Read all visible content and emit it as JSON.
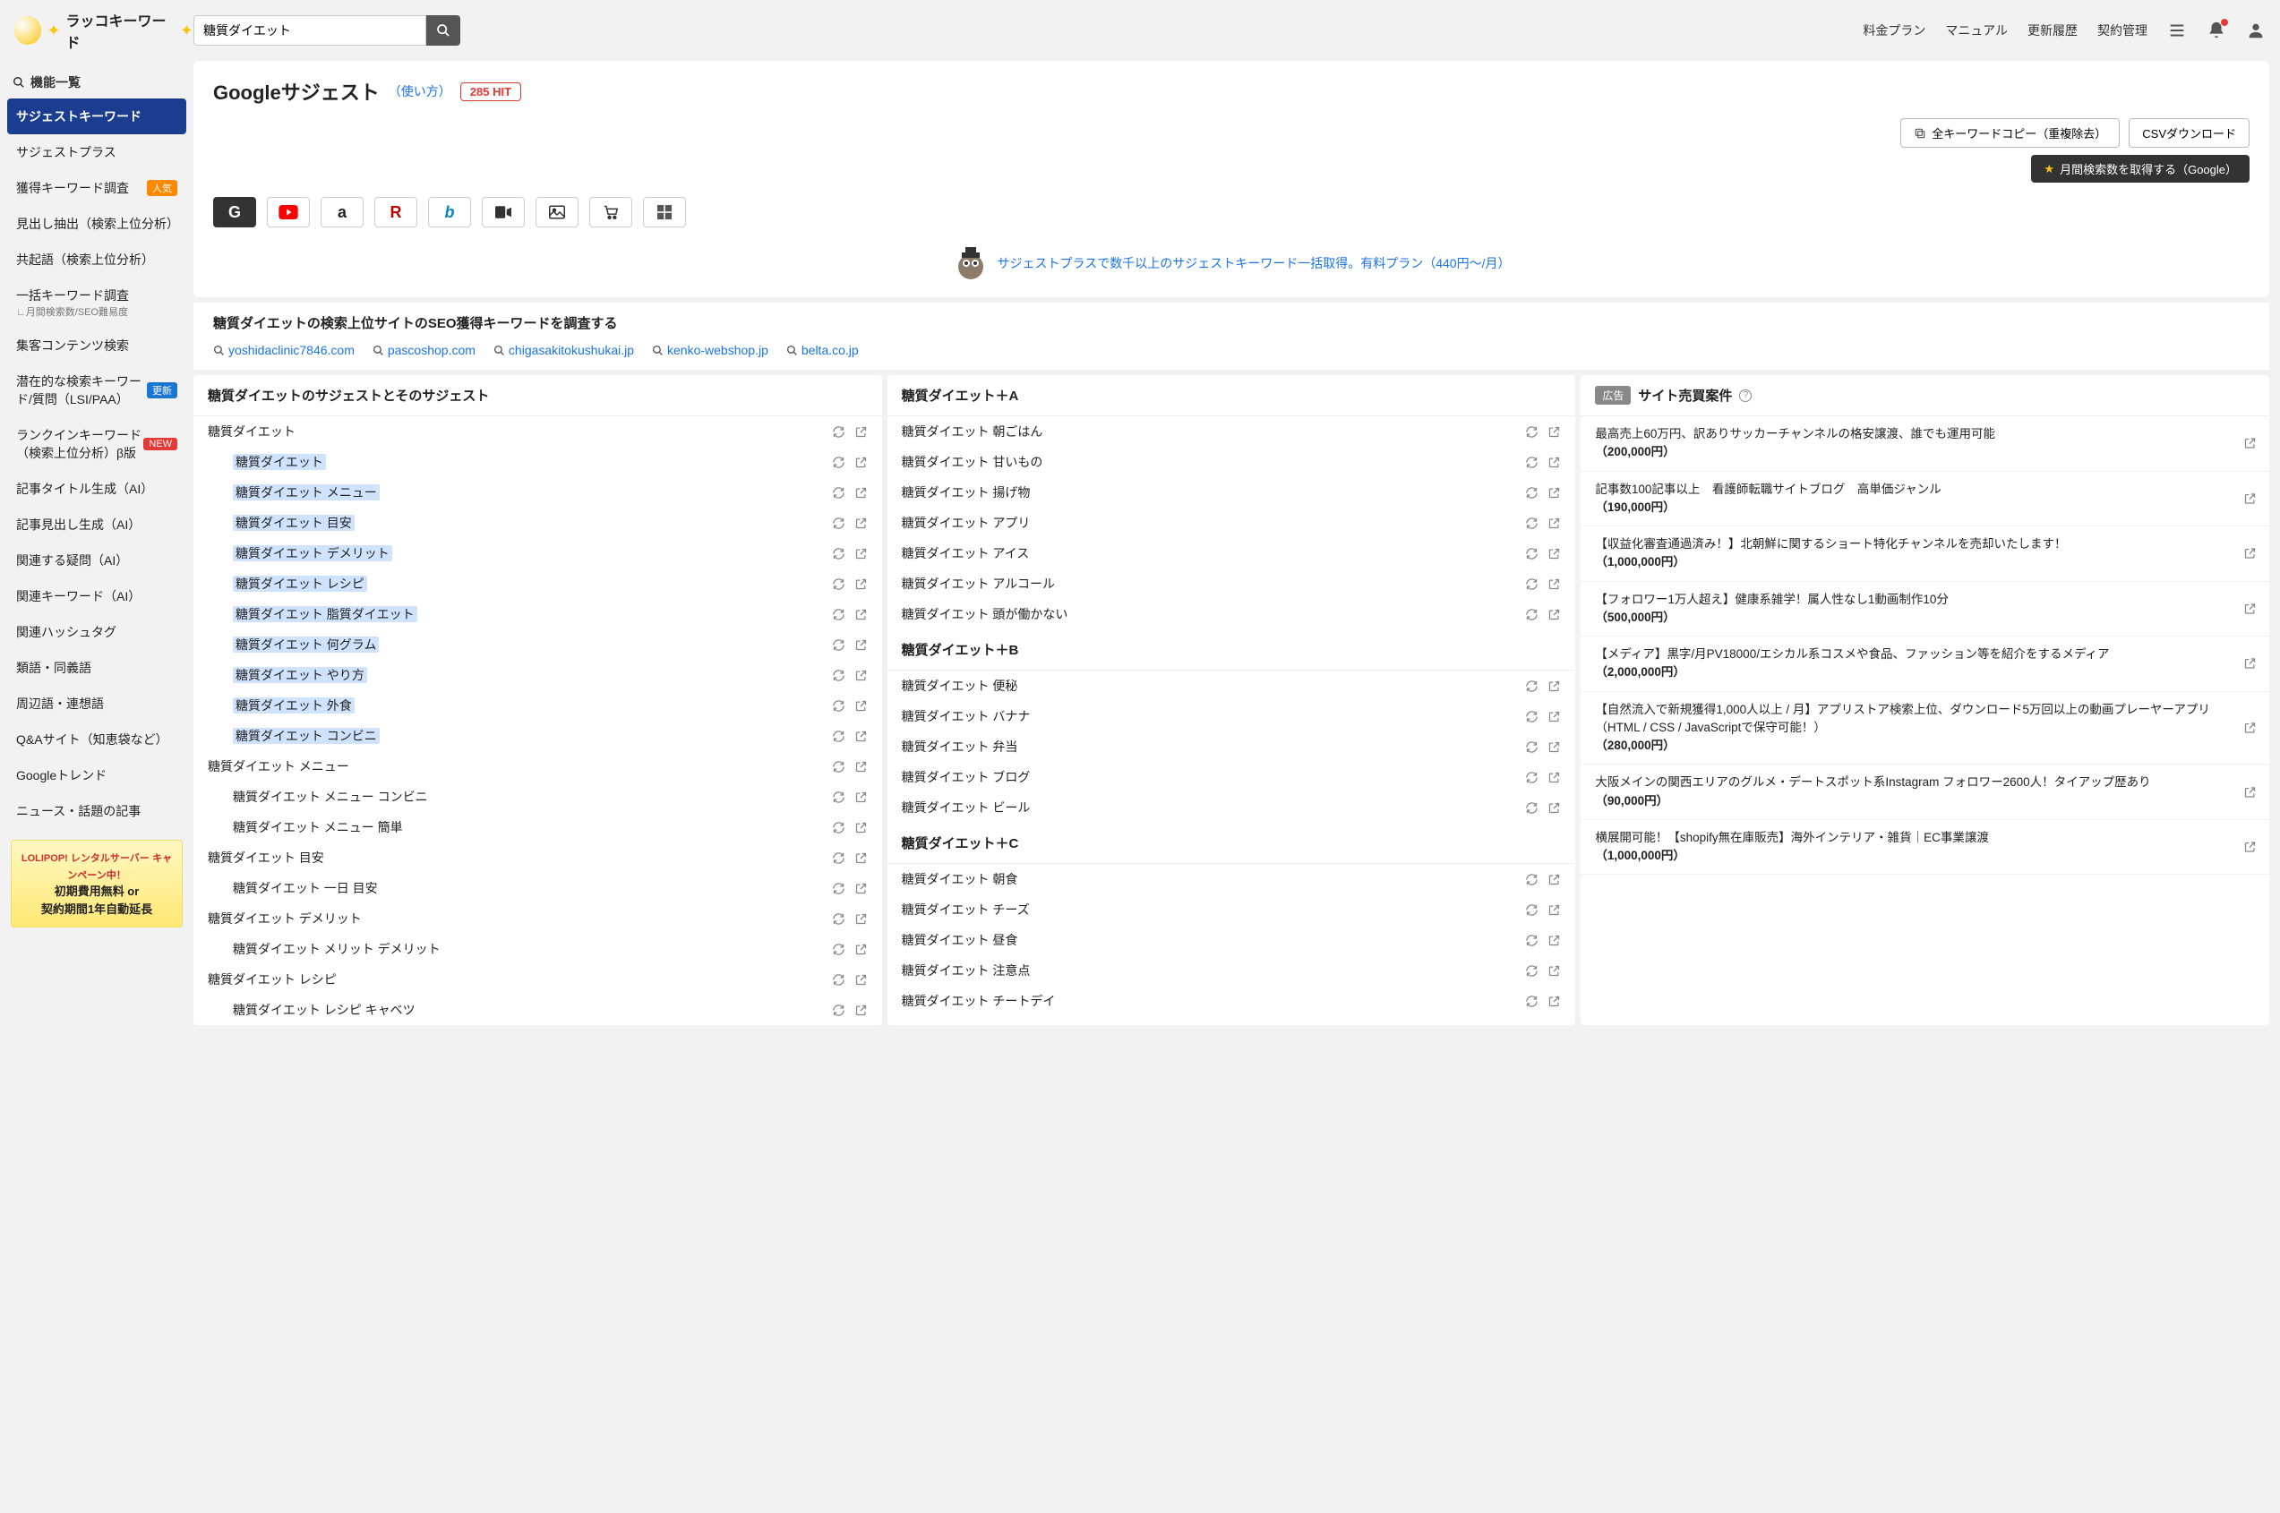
{
  "logo_text": "ラッコキーワード",
  "search": {
    "value": "糖質ダイエット"
  },
  "header_links": [
    "料金プラン",
    "マニュアル",
    "更新履歴",
    "契約管理"
  ],
  "sidebar": {
    "heading": "機能一覧",
    "items": [
      {
        "label": "サジェストキーワード",
        "active": true
      },
      {
        "label": "サジェストプラス"
      },
      {
        "label": "獲得キーワード調査",
        "badge": "人気",
        "badge_class": "badge-pop"
      },
      {
        "label": "見出し抽出（検索上位分析）"
      },
      {
        "label": "共起語（検索上位分析）"
      },
      {
        "label": "一括キーワード調査",
        "sub": "∟月間検索数/SEO難易度"
      },
      {
        "label": "集客コンテンツ検索"
      },
      {
        "label": "潜在的な検索キーワード/質問（LSI/PAA）",
        "badge": "更新",
        "badge_class": "badge-upd"
      },
      {
        "label": "ランクインキーワード（検索上位分析）β版",
        "badge": "NEW",
        "badge_class": "badge-new"
      },
      {
        "label": "記事タイトル生成（AI）"
      },
      {
        "label": "記事見出し生成（AI）"
      },
      {
        "label": "関連する疑問（AI）"
      },
      {
        "label": "関連キーワード（AI）"
      },
      {
        "label": "関連ハッシュタグ"
      },
      {
        "label": "類語・同義語"
      },
      {
        "label": "周辺語・連想語"
      },
      {
        "label": "Q&Aサイト（知恵袋など）"
      },
      {
        "label": "Googleトレンド"
      },
      {
        "label": "ニュース・話題の記事"
      }
    ],
    "ad": {
      "brand": "LOLIPOP! レンタルサーバー",
      "campaign": "キャンペーン中！",
      "line1": "初期費用無料 or",
      "line2": "契約期間1年自動延長"
    }
  },
  "page": {
    "title": "Googleサジェスト",
    "usage": "（使い方）",
    "hit": "285 HIT",
    "copy_btn": "全キーワードコピー（重複除去）",
    "csv_btn": "CSVダウンロード",
    "volume_btn": "月間検索数を取得する（Google）",
    "promo": "サジェストプラスで数千以上のサジェストキーワード一括取得。有料プラン（440円〜/月）",
    "seo_heading": "糖質ダイエットの検索上位サイトのSEO獲得キーワードを調査する",
    "domains": [
      "yoshidaclinic7846.com",
      "pascoshop.com",
      "chigasakitokushukai.jp",
      "kenko-webshop.jp",
      "belta.co.jp"
    ]
  },
  "col1": {
    "header": "糖質ダイエットのサジェストとそのサジェスト",
    "groups": [
      {
        "title": "糖質ダイエット",
        "items": [
          {
            "t": "糖質ダイエット",
            "hl": true
          },
          {
            "t": "糖質ダイエット メニュー",
            "hl": true
          },
          {
            "t": "糖質ダイエット 目安",
            "hl": true
          },
          {
            "t": "糖質ダイエット デメリット",
            "hl": true
          },
          {
            "t": "糖質ダイエット レシピ",
            "hl": true
          },
          {
            "t": "糖質ダイエット 脂質ダイエット",
            "hl": true
          },
          {
            "t": "糖質ダイエット 何グラム",
            "hl": true
          },
          {
            "t": "糖質ダイエット やり方",
            "hl": true
          },
          {
            "t": "糖質ダイエット 外食",
            "hl": true
          },
          {
            "t": "糖質ダイエット コンビニ",
            "hl": true
          }
        ]
      },
      {
        "title": "糖質ダイエット メニュー",
        "items": [
          {
            "t": "糖質ダイエット メニュー コンビニ"
          },
          {
            "t": "糖質ダイエット メニュー 簡単"
          }
        ]
      },
      {
        "title": "糖質ダイエット 目安",
        "items": [
          {
            "t": "糖質ダイエット 一日 目安"
          }
        ]
      },
      {
        "title": "糖質ダイエット デメリット",
        "items": [
          {
            "t": "糖質ダイエット メリット デメリット"
          }
        ]
      },
      {
        "title": "糖質ダイエット レシピ",
        "items": [
          {
            "t": "糖質ダイエット レシピ キャベツ"
          }
        ]
      }
    ]
  },
  "col2": {
    "sections": [
      {
        "header": "糖質ダイエット＋A",
        "items": [
          "糖質ダイエット 朝ごはん",
          "糖質ダイエット 甘いもの",
          "糖質ダイエット 揚げ物",
          "糖質ダイエット アプリ",
          "糖質ダイエット アイス",
          "糖質ダイエット アルコール",
          "糖質ダイエット 頭が働かない"
        ]
      },
      {
        "header": "糖質ダイエット＋B",
        "items": [
          "糖質ダイエット 便秘",
          "糖質ダイエット バナナ",
          "糖質ダイエット 弁当",
          "糖質ダイエット ブログ",
          "糖質ダイエット ビール"
        ]
      },
      {
        "header": "糖質ダイエット＋C",
        "items": [
          "糖質ダイエット 朝食",
          "糖質ダイエット チーズ",
          "糖質ダイエット 昼食",
          "糖質ダイエット 注意点",
          "糖質ダイエット チートデイ"
        ]
      }
    ]
  },
  "col3": {
    "pill": "広告",
    "title": "サイト売買案件",
    "items": [
      {
        "t": "最高売上60万円、訳ありサッカーチャンネルの格安譲渡、誰でも運用可能",
        "p": "（200,000円）"
      },
      {
        "t": "記事数100記事以上　看護師転職サイトブログ　高単価ジャンル",
        "p": "（190,000円）"
      },
      {
        "t": "【収益化審査通過済み！】北朝鮮に関するショート特化チャンネルを売却いたします！",
        "p": "（1,000,000円）"
      },
      {
        "t": "【フォロワー1万人超え】健康系雑学！属人性なし1動画制作10分",
        "p": "（500,000円）"
      },
      {
        "t": "【メディア】黒字/月PV18000/エシカル系コスメや食品、ファッション等を紹介をするメディア",
        "p": "（2,000,000円）"
      },
      {
        "t": "【自然流入で新規獲得1,000人以上 / 月】アプリストア検索上位、ダウンロード5万回以上の動画プレーヤーアプリ（HTML / CSS / JavaScriptで保守可能！）",
        "p": "（280,000円）"
      },
      {
        "t": "大阪メインの関西エリアのグルメ・デートスポット系Instagram フォロワー2600人！タイアップ歴あり",
        "p": "（90,000円）"
      },
      {
        "t": "横展開可能！【shopify無在庫販売】海外インテリア・雑貨｜EC事業譲渡",
        "p": "（1,000,000円）"
      }
    ]
  }
}
